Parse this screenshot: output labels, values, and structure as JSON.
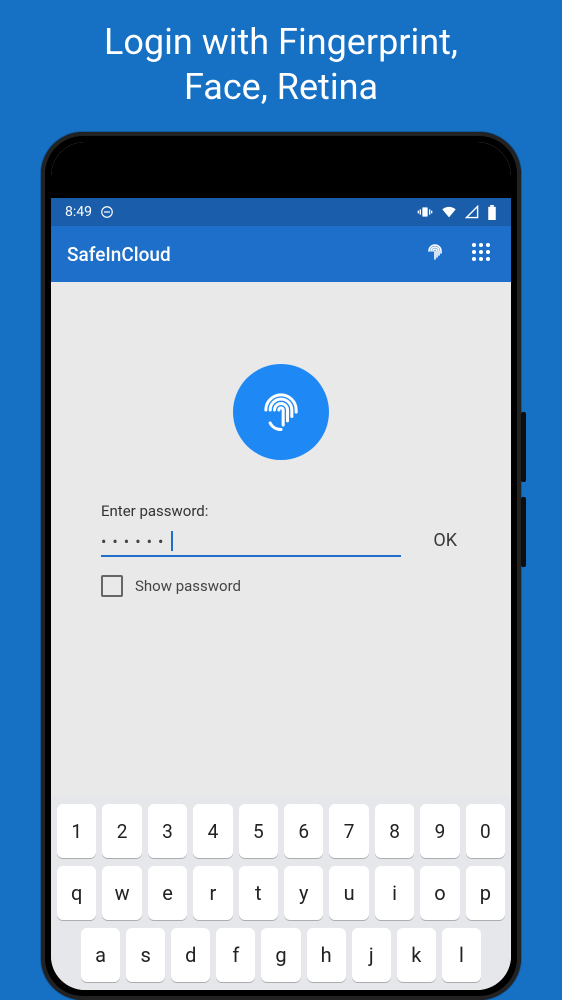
{
  "promo": {
    "line1": "Login with Fingerprint,",
    "line2": "Face, Retina"
  },
  "statusbar": {
    "time": "8:49"
  },
  "appbar": {
    "title": "SafeInCloud"
  },
  "login": {
    "label": "Enter password:",
    "masked": "••••••",
    "ok": "OK",
    "show_password": "Show password"
  },
  "keyboard": {
    "row1": [
      "1",
      "2",
      "3",
      "4",
      "5",
      "6",
      "7",
      "8",
      "9",
      "0"
    ],
    "row2": [
      "q",
      "w",
      "e",
      "r",
      "t",
      "y",
      "u",
      "i",
      "o",
      "p"
    ],
    "row3": [
      "a",
      "s",
      "d",
      "f",
      "g",
      "h",
      "j",
      "k",
      "l"
    ]
  },
  "colors": {
    "page_bg": "#1670c4",
    "appbar": "#1e6fc9",
    "statusbar": "#1a5eab",
    "accent": "#1e88f5"
  }
}
